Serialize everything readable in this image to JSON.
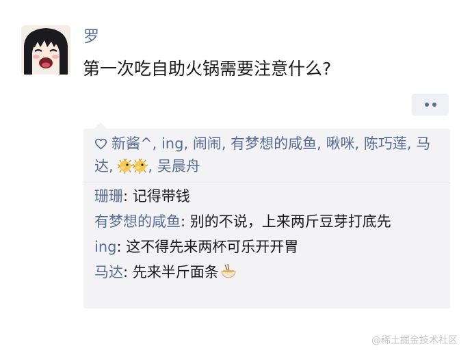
{
  "post": {
    "username": "罗",
    "text": "第一次吃自助火锅需要注意什么?"
  },
  "likes": {
    "icon": "heart-outline-icon",
    "names": [
      "新酱^",
      "ing",
      "闹闹",
      "有梦想的咸鱼",
      "啾咪",
      "陈巧莲",
      "马达",
      "[puffer-fish-emoji][puffer-fish-emoji]",
      "吴晨舟"
    ],
    "separator": ", "
  },
  "comments": [
    {
      "author": "珊珊",
      "colon": ": ",
      "text": "记得带钱",
      "emoji": ""
    },
    {
      "author": "有梦想的咸鱼",
      "colon": ": ",
      "text": "别的不说，上来两斤豆芽打底先",
      "emoji": ""
    },
    {
      "author": "ing",
      "colon": ": ",
      "text": "这不得先来两杯可乐开开胃",
      "emoji": ""
    },
    {
      "author": "马达",
      "colon": ": ",
      "text": "先来半斤面条",
      "emoji": "noodle-bowl-emoji"
    }
  ],
  "watermark": "@稀土掘金技术社区",
  "colors": {
    "name_blue": "#576b95",
    "text": "#1a1a1a",
    "box_bg": "#f3f3f5"
  }
}
